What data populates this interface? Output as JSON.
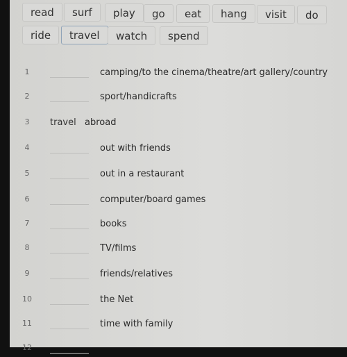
{
  "word_bank": [
    "read",
    "surf",
    "play",
    "go",
    "eat",
    "hang",
    "visit",
    "do",
    "ride",
    "travel",
    "watch",
    "spend"
  ],
  "selected_word": "travel",
  "items": [
    {
      "num": "1",
      "answer": "",
      "text": "camping/to the cinema/theatre/art gallery/country"
    },
    {
      "num": "2",
      "answer": "",
      "text": "sport/handicrafts"
    },
    {
      "num": "3",
      "answer": "travel",
      "text": "abroad"
    },
    {
      "num": "4",
      "answer": "",
      "text": "out with friends"
    },
    {
      "num": "5",
      "answer": "",
      "text": "out in a restaurant"
    },
    {
      "num": "6",
      "answer": "",
      "text": "computer/board games"
    },
    {
      "num": "7",
      "answer": "",
      "text": "books"
    },
    {
      "num": "8",
      "answer": "",
      "text": "TV/films"
    },
    {
      "num": "9",
      "answer": "",
      "text": "friends/relatives"
    },
    {
      "num": "10",
      "answer": "",
      "text": "the Net"
    },
    {
      "num": "11",
      "answer": "",
      "text": "time with family"
    },
    {
      "num": "12",
      "answer": "",
      "text": ""
    }
  ]
}
